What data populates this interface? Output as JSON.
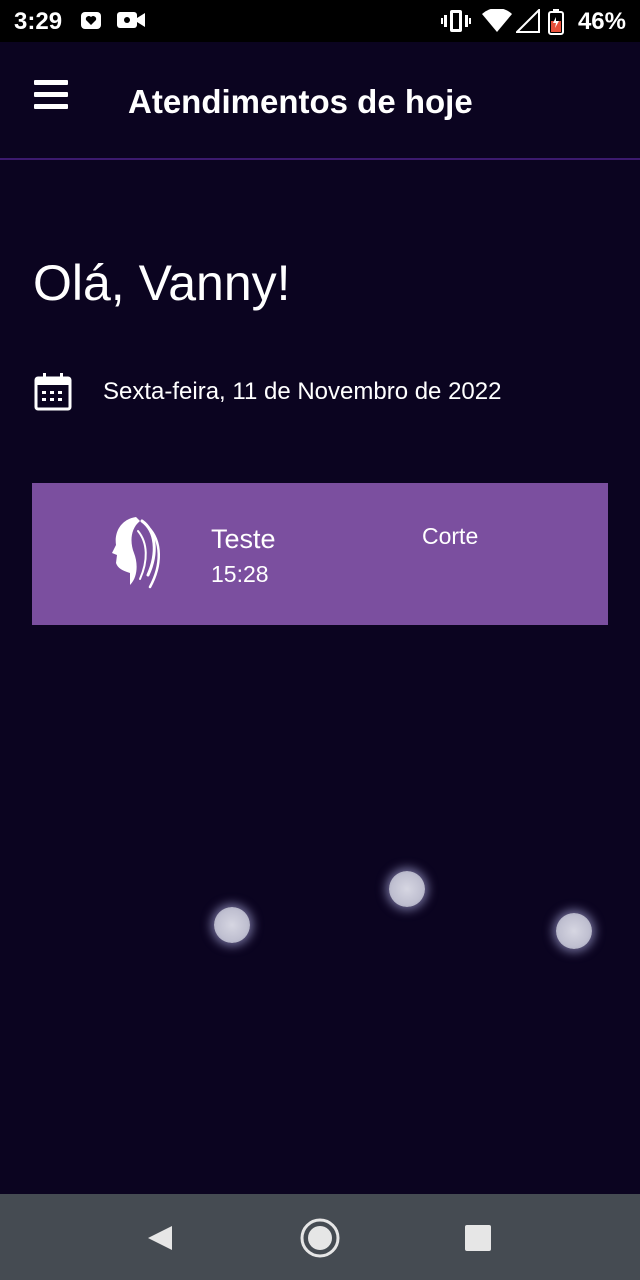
{
  "status_bar": {
    "time": "3:29",
    "battery_percent": "46%",
    "icons": [
      "notification-app-icon",
      "video-camera-icon",
      "vibrate-icon",
      "wifi-icon",
      "signal-icon",
      "battery-icon"
    ]
  },
  "app_bar": {
    "title": "Atendimentos de hoje",
    "menu_icon": "hamburger-menu-icon"
  },
  "greeting": "Olá, Vanny!",
  "date": {
    "icon": "calendar-icon",
    "text": "Sexta-feira, 11 de Novembro de 2022"
  },
  "appointments": [
    {
      "client": "Teste",
      "time": "15:28",
      "service": "Corte",
      "icon": "woman-hair-logo-icon"
    }
  ],
  "navigation": {
    "buttons": [
      "back-icon",
      "home-icon",
      "recents-icon"
    ]
  },
  "colors": {
    "background": "#0b0420",
    "card": "#7b4f9f",
    "nav_bar": "#454b52",
    "divider": "#3c1a6e"
  }
}
